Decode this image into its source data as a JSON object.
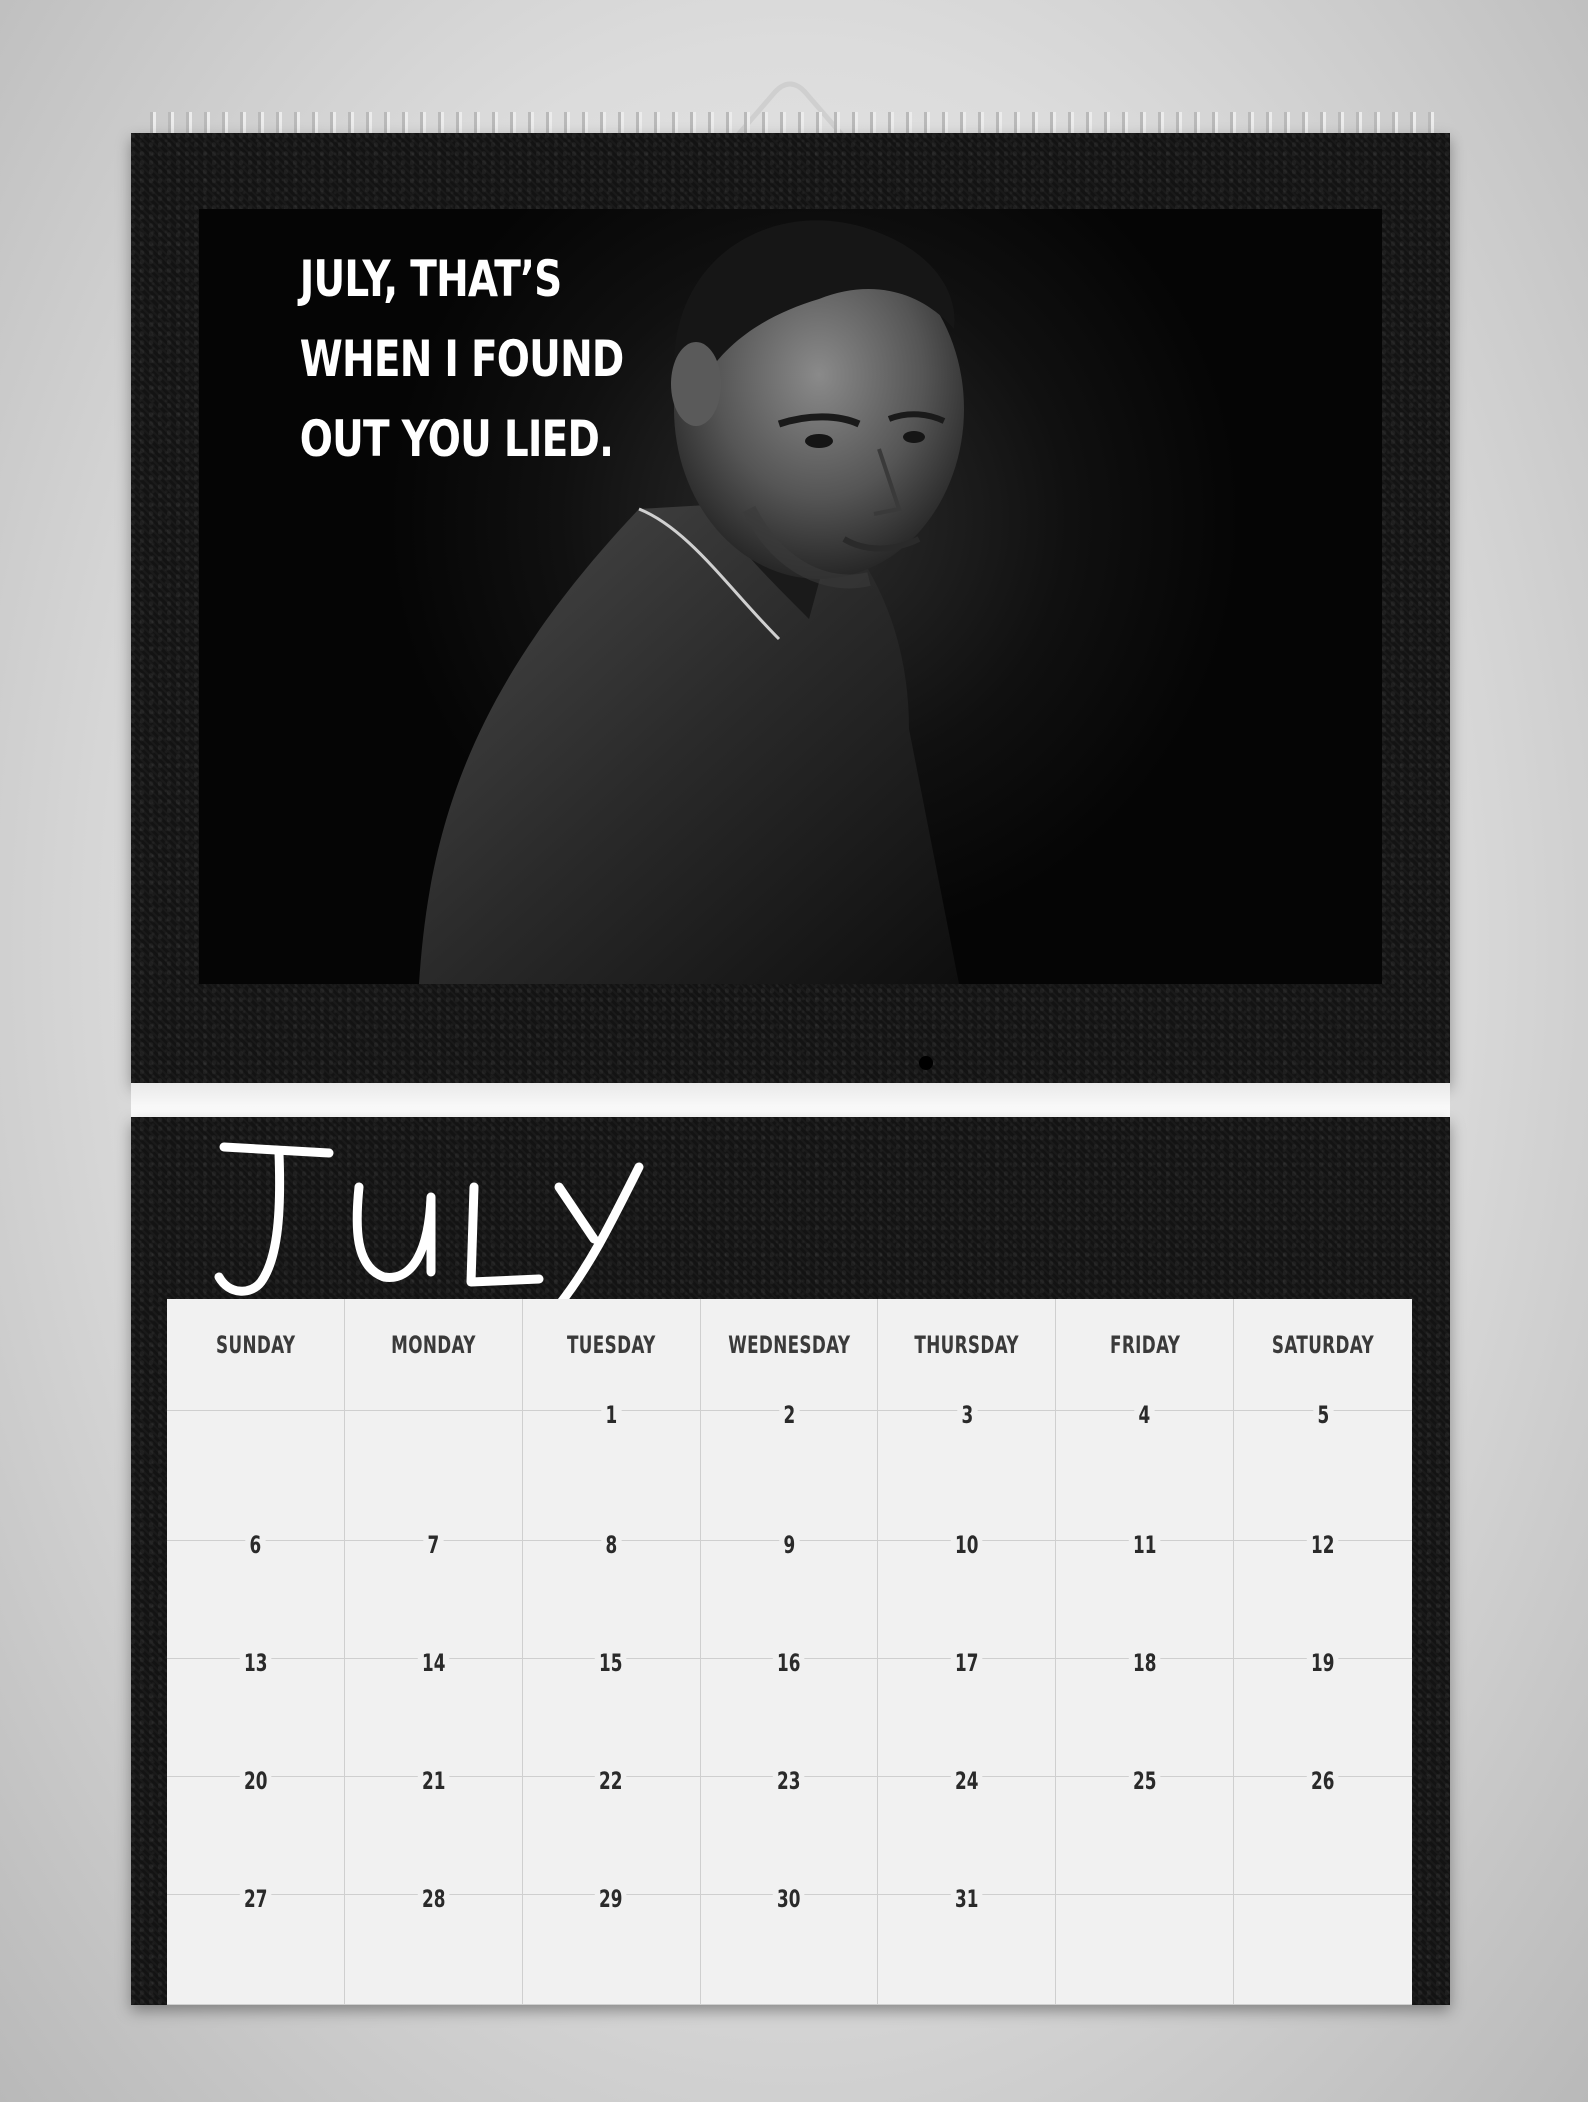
{
  "calendar": {
    "photo": {
      "quote_lines": [
        "JULY, THAT’S",
        "WHEN I FOUND",
        "OUT YOU LIED."
      ]
    },
    "month": "JULY",
    "weekdays": [
      "SUNDAY",
      "MONDAY",
      "TUESDAY",
      "WEDNESDAY",
      "THURSDAY",
      "FRIDAY",
      "SATURDAY"
    ],
    "weeks": [
      [
        "",
        "",
        "1",
        "2",
        "3",
        "4",
        "5"
      ],
      [
        "6",
        "7",
        "8",
        "9",
        "10",
        "11",
        "12"
      ],
      [
        "13",
        "14",
        "15",
        "16",
        "17",
        "18",
        "19"
      ],
      [
        "20",
        "21",
        "22",
        "23",
        "24",
        "25",
        "26"
      ],
      [
        "27",
        "28",
        "29",
        "30",
        "31",
        "",
        ""
      ]
    ]
  }
}
